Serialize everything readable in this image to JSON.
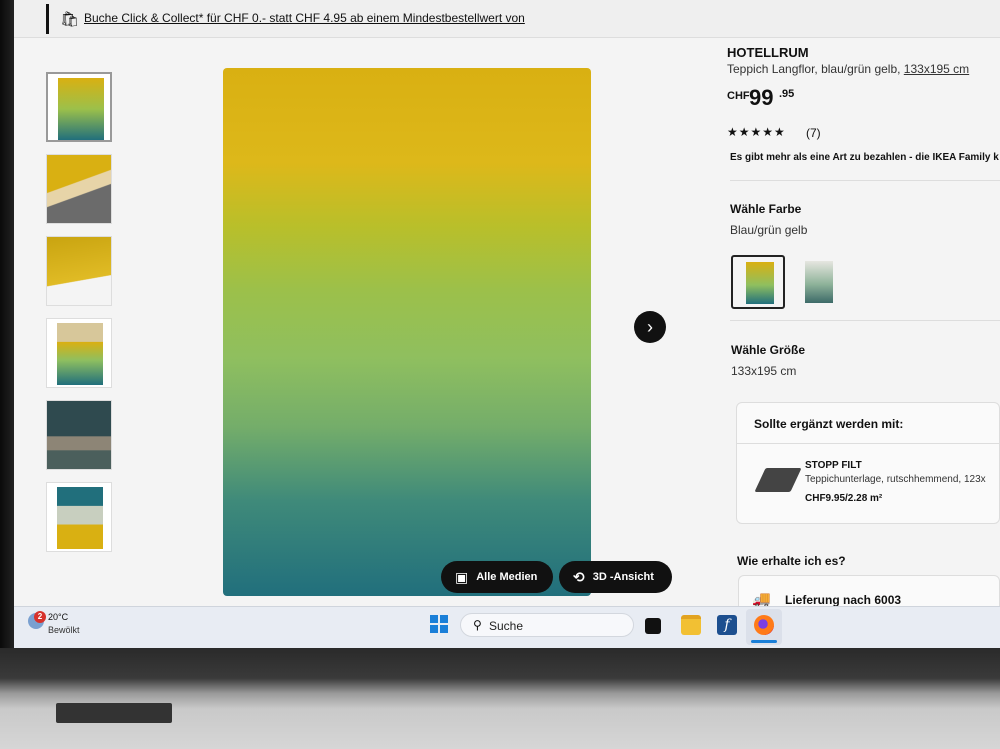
{
  "banner": {
    "text": "Buche Click & Collect* für CHF 0.- statt CHF 4.95 ab einem Mindestbestellwert von",
    "icon": "shopping-bag-icon"
  },
  "gallery": {
    "thumbnails": [
      {
        "alt": "rug-front"
      },
      {
        "alt": "rug-backside"
      },
      {
        "alt": "rug-texture"
      },
      {
        "alt": "rug-room-corner"
      },
      {
        "alt": "living-room"
      },
      {
        "alt": "rug-color-variants"
      }
    ],
    "next_icon": "chevron-right-icon",
    "all_media_label": "Alle Medien",
    "view_3d_label": "3D -Ansicht"
  },
  "product": {
    "name": "HOTELLRUM",
    "description": "Teppich Langflor, blau/grün gelb, ",
    "size_link": "133x195 cm",
    "currency": "CHF",
    "price_main": "99",
    "price_cents": ".95",
    "stars": "★★★★★",
    "rating": 4.5,
    "rating_count": "(7)",
    "payment_info": "Es gibt mehr als eine Art zu bezahlen - die IKEA Family k",
    "color_heading": "Wähle Farbe",
    "color_value": "Blau/grün gelb",
    "size_heading": "Wähle Größe",
    "size_value": "133x195 cm"
  },
  "addon": {
    "heading": "Sollte ergänzt werden mit:",
    "name": "STOPP FILT",
    "description": "Teppichunterlage, rutschhemmend, 123x",
    "price": "CHF9.95/2.28 m²"
  },
  "delivery": {
    "heading": "Wie erhalte ich es?",
    "label": "Lieferung nach 6003",
    "icon": "truck-icon"
  },
  "taskbar": {
    "badge": "2",
    "temperature": "20°C",
    "condition": "Bewölkt",
    "search_placeholder": "Suche",
    "apps": [
      "task-view",
      "file-explorer",
      "font-app",
      "firefox"
    ]
  },
  "colors": {
    "accent": "#111111",
    "rug_yellow": "#d9b012",
    "rug_teal": "#216f7c",
    "windows_blue": "#1a7fd8"
  }
}
